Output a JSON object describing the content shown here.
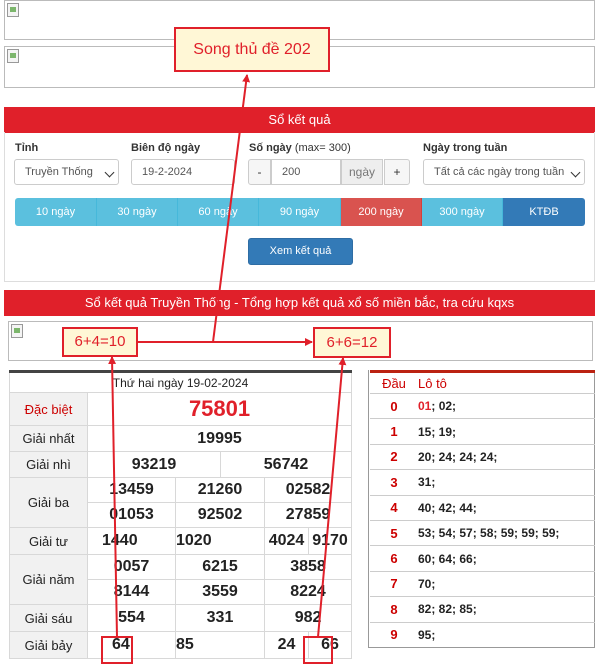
{
  "top_note": "Song thủ đề 202",
  "search_bar": "Sổ kết quả",
  "form": {
    "province_label": "Tỉnh",
    "province_value": "Truyền Thống",
    "date_label": "Biên độ ngày",
    "date_value": "19-2-2024",
    "days_label": "Số ngày",
    "days_hint": "(max= 300)",
    "days_value": "200",
    "days_unit": "ngày",
    "minus": "-",
    "plus": "+",
    "weekday_label": "Ngày trong tuần",
    "weekday_value": "Tất cả các ngày trong tuần"
  },
  "range_buttons": [
    "10 ngày",
    "30 ngày",
    "60 ngày",
    "90 ngày",
    "200 ngày",
    "300 ngày",
    "KTĐB"
  ],
  "submit": "Xem kết quả",
  "results_bar": "Sổ kết quả Truyền Thống - Tổng hợp kết quả xổ số miền bắc, tra cứu kqxs",
  "notes": {
    "left": "6+4=10",
    "right": "6+6=12"
  },
  "results": {
    "date": "Thứ hai ngày 19-02-2024",
    "special_label": "Đặc biệt",
    "special": "75801",
    "first_label": "Giải nhất",
    "first": "19995",
    "second_label": "Giải nhì",
    "second": [
      "93219",
      "56742"
    ],
    "third_label": "Giải ba",
    "third": [
      "13459",
      "21260",
      "02582",
      "01053",
      "92502",
      "27859"
    ],
    "fourth_label": "Giải tư",
    "fourth": [
      "1440",
      "1020",
      "4024",
      "9170"
    ],
    "fifth_label": "Giải năm",
    "fifth": [
      "0057",
      "6215",
      "3858",
      "8144",
      "3559",
      "8224"
    ],
    "sixth_label": "Giải sáu",
    "sixth": [
      "554",
      "331",
      "982"
    ],
    "seventh_label": "Giải bảy",
    "seventh": [
      "64",
      "85",
      "24",
      "66"
    ]
  },
  "loto": {
    "col_dau": "Đầu",
    "col_loto": "Lô tô",
    "rows": [
      {
        "dau": "0",
        "special": "01",
        "rest": "; 02;"
      },
      {
        "dau": "1",
        "special": "",
        "rest": "15; 19;"
      },
      {
        "dau": "2",
        "special": "",
        "rest": "20; 24; 24; 24;"
      },
      {
        "dau": "3",
        "special": "",
        "rest": "31;"
      },
      {
        "dau": "4",
        "special": "",
        "rest": "40; 42; 44;"
      },
      {
        "dau": "5",
        "special": "",
        "rest": "53; 54; 57; 58; 59; 59; 59;"
      },
      {
        "dau": "6",
        "special": "",
        "rest": "60; 64; 66;"
      },
      {
        "dau": "7",
        "special": "",
        "rest": "70;"
      },
      {
        "dau": "8",
        "special": "",
        "rest": "82; 82; 85;"
      },
      {
        "dau": "9",
        "special": "",
        "rest": "95;"
      }
    ]
  },
  "colors": {
    "red_bar": "#e0202a",
    "range_button": "#5bc0de",
    "range_active": "#d9534f",
    "ktdb": "#337ab7",
    "submit": "#337ab7"
  }
}
